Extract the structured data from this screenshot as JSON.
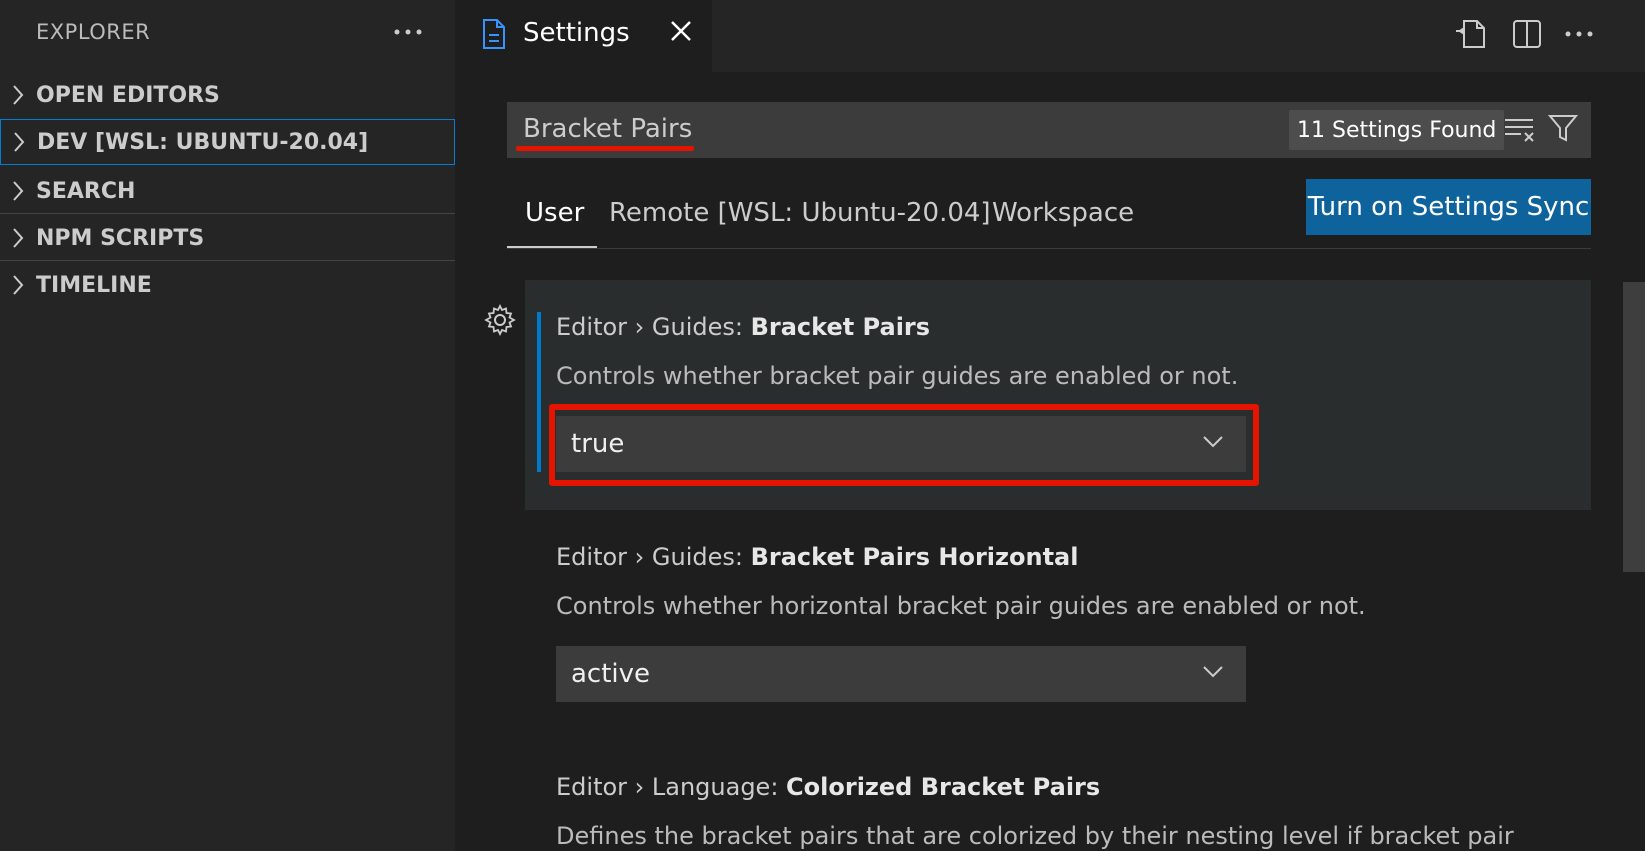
{
  "sidebar": {
    "title": "EXPLORER",
    "sections": [
      {
        "label": "OPEN EDITORS"
      },
      {
        "label": "DEV [WSL: UBUNTU-20.04]"
      },
      {
        "label": "SEARCH"
      },
      {
        "label": "NPM SCRIPTS"
      },
      {
        "label": "TIMELINE"
      }
    ]
  },
  "tabs": [
    {
      "label": "Settings",
      "icon": "file-icon"
    }
  ],
  "search": {
    "value": "Bracket Pairs",
    "results_count": "11 Settings Found"
  },
  "scope_tabs": [
    {
      "label": "User"
    },
    {
      "label": "Remote [WSL: Ubuntu-20.04]"
    },
    {
      "label": "Workspace"
    }
  ],
  "sync_button": "Turn on Settings Sync",
  "settings": [
    {
      "category": "Editor › Guides: ",
      "name": "Bracket Pairs",
      "description": "Controls whether bracket pair guides are enabled or not.",
      "value": "true"
    },
    {
      "category": "Editor › Guides: ",
      "name": "Bracket Pairs Horizontal",
      "description": "Controls whether horizontal bracket pair guides are enabled or not.",
      "value": "active"
    },
    {
      "category": "Editor › Language: ",
      "name": "Colorized Bracket Pairs",
      "description": "Defines the bracket pairs that are colorized by their nesting level if bracket pair"
    }
  ],
  "colors": {
    "accent": "#007acc",
    "highlight": "#e51400",
    "button": "#0e639c"
  }
}
